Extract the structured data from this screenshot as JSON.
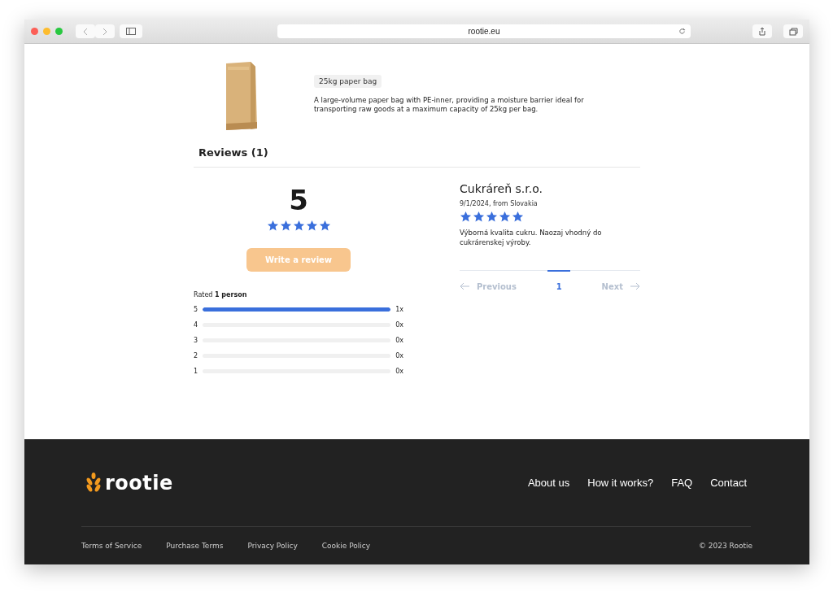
{
  "browser": {
    "url": "rootie.eu"
  },
  "product": {
    "tag": "25kg paper bag",
    "description": "A large-volume paper bag with PE-inner, providing a moisture barrier ideal for transporting raw goods at a maximum capacity of 25kg per bag."
  },
  "reviews": {
    "title": "Reviews (1)",
    "average": "5",
    "stars": 5,
    "write_button": {
      "label": "Write a review",
      "disabled": true
    },
    "rated": "Rated **1 person**",
    "distribution": [
      {
        "label": "5",
        "level": 1,
        "count": "1x"
      },
      {
        "label": "4",
        "level": 0,
        "count": "0x"
      },
      {
        "label": "3",
        "level": 0,
        "count": "0x"
      },
      {
        "label": "2",
        "level": 0,
        "count": "0x"
      },
      {
        "label": "1",
        "level": 0,
        "count": "0x"
      }
    ],
    "items": [
      {
        "author": "Cukráreň s.r.o.",
        "meta": "9/1/2024, from Slovakia",
        "stars": 5,
        "text": "Výborná kvalita cukru. Naozaj vhodný do cukrárenskej výroby."
      }
    ],
    "pagination": {
      "previous": {
        "label": "Previous",
        "disabled": true
      },
      "pages": [
        {
          "label": "1",
          "selected": true
        }
      ],
      "next": {
        "label": "Next",
        "disabled": true
      }
    }
  },
  "footer": {
    "logo": "rootie",
    "nav": [
      "About us",
      "How it works?",
      "FAQ",
      "Contact"
    ],
    "legal": [
      "Terms of Service",
      "Purchase Terms",
      "Privacy Policy",
      "Cookie Policy"
    ],
    "copyright": "© 2023 Rootie"
  }
}
